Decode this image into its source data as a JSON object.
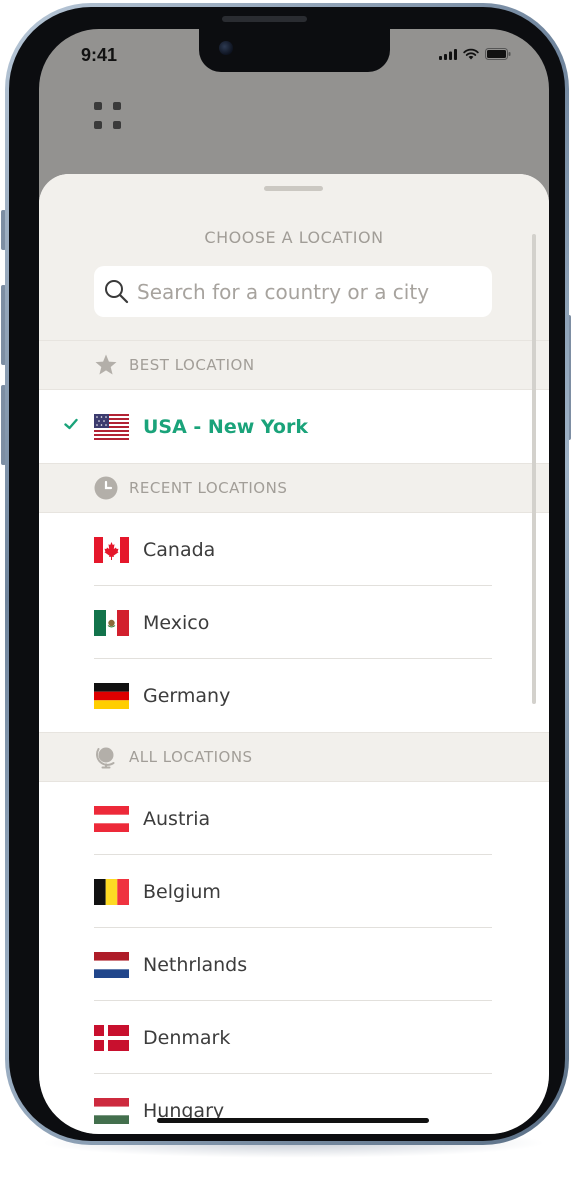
{
  "status_bar": {
    "time": "9:41"
  },
  "sheet": {
    "title": "CHOOSE A LOCATION",
    "search": {
      "placeholder": "Search for a country or a city",
      "value": ""
    }
  },
  "best_section": {
    "header": "BEST LOCATION",
    "icon": "star-icon",
    "selected": {
      "name": "USA - New York",
      "flag": "flag-usa",
      "checked": true
    }
  },
  "recent_section": {
    "header": "RECENT LOCATIONS",
    "icon": "clock-icon",
    "items": [
      {
        "name": "Canada",
        "flag": "flag-canada"
      },
      {
        "name": "Mexico",
        "flag": "flag-mexico"
      },
      {
        "name": "Germany",
        "flag": "flag-germany"
      }
    ]
  },
  "all_section": {
    "header": "ALL LOCATIONS",
    "icon": "globe-icon",
    "items": [
      {
        "name": "Austria",
        "flag": "flag-austria"
      },
      {
        "name": "Belgium",
        "flag": "flag-belgium"
      },
      {
        "name": "Nethrlands",
        "flag": "flag-netherlands"
      },
      {
        "name": "Denmark",
        "flag": "flag-denmark"
      },
      {
        "name": "Hungary",
        "flag": "flag-hungary"
      }
    ]
  },
  "colors": {
    "accent_green": "#1aa37a",
    "section_bg": "#f2f0ec",
    "muted_text": "#a29e98",
    "backdrop": "#939290"
  }
}
